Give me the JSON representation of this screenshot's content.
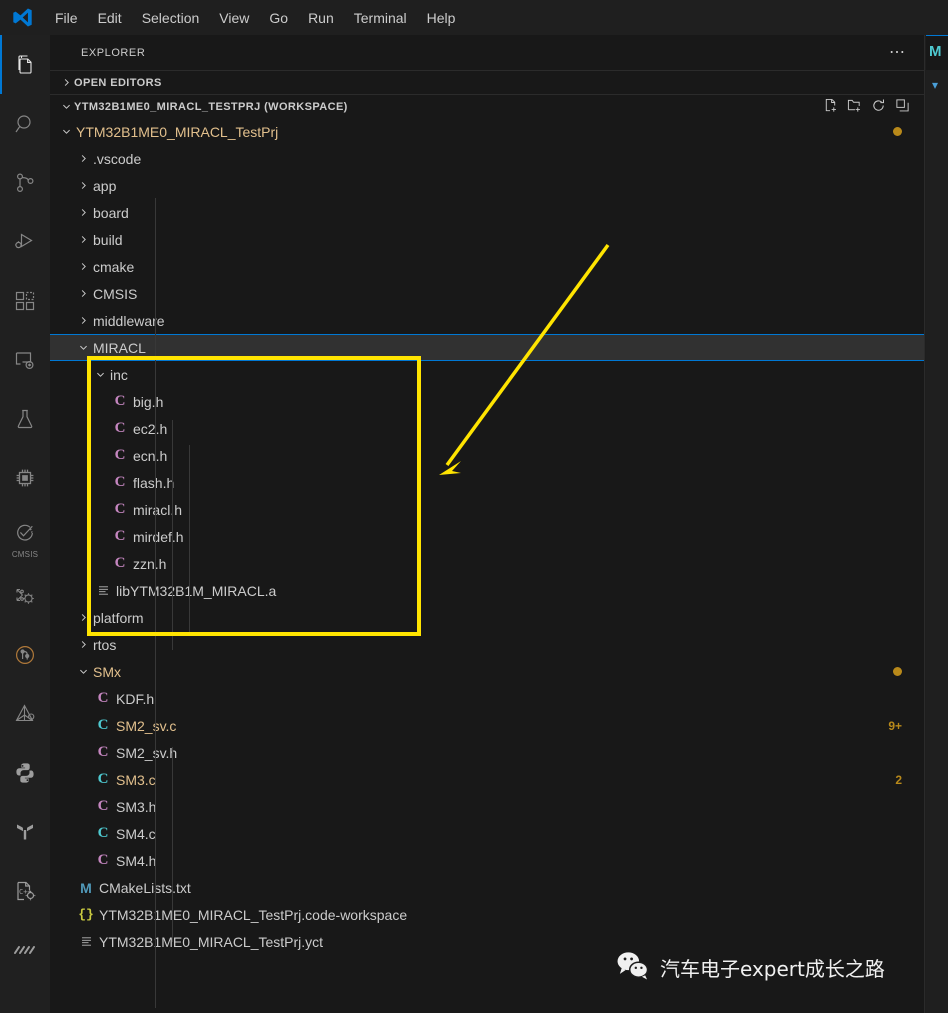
{
  "window": {
    "logo_icon": "vscode-logo-icon",
    "menu": [
      "File",
      "Edit",
      "Selection",
      "View",
      "Go",
      "Run",
      "Terminal",
      "Help"
    ]
  },
  "activity_bar": {
    "items": [
      {
        "name": "explorer",
        "icon": "files-icon",
        "active": true,
        "label": ""
      },
      {
        "name": "search",
        "icon": "search-icon",
        "active": false,
        "label": ""
      },
      {
        "name": "source-control",
        "icon": "source-control-icon",
        "active": false,
        "label": ""
      },
      {
        "name": "run-and-debug",
        "icon": "run-debug-icon",
        "active": false,
        "label": ""
      },
      {
        "name": "extensions",
        "icon": "extensions-icon",
        "active": false,
        "label": ""
      },
      {
        "name": "remote-explorer",
        "icon": "remote-explorer-icon",
        "active": false,
        "label": ""
      },
      {
        "name": "testing",
        "icon": "beaker-icon",
        "active": false,
        "label": ""
      },
      {
        "name": "embedded-tools",
        "icon": "chip-icon",
        "active": false,
        "label": ""
      },
      {
        "name": "cmsis",
        "icon": "cmsis-icon",
        "active": false,
        "label": "CMSIS"
      },
      {
        "name": "peripherals",
        "icon": "peripherals-gear-icon",
        "active": false,
        "label": ""
      },
      {
        "name": "git-graph",
        "icon": "git-graph-icon",
        "active": false,
        "label": ""
      },
      {
        "name": "embedded-debug",
        "icon": "triangle-debug-icon",
        "active": false,
        "label": ""
      },
      {
        "name": "python",
        "icon": "python-icon",
        "active": false,
        "label": ""
      },
      {
        "name": "platformio",
        "icon": "platformio-icon",
        "active": false,
        "label": ""
      },
      {
        "name": "cpp-config",
        "icon": "cpp-settings-icon",
        "active": false,
        "label": ""
      },
      {
        "name": "serial-monitor",
        "icon": "waveform-icon",
        "active": false,
        "label": ""
      }
    ]
  },
  "sidebar": {
    "title": "EXPLORER",
    "more_actions_icon": "ellipsis-icon",
    "open_editors": {
      "label": "OPEN EDITORS",
      "twisty": "chevron-right-icon",
      "expanded": false
    },
    "workspace": {
      "label": "YTM32B1ME0_MIRACL_TESTPRJ (WORKSPACE)",
      "twisty": "chevron-down-icon",
      "expanded": true,
      "actions": [
        {
          "name": "new-file-icon",
          "title": "New File"
        },
        {
          "name": "new-folder-icon",
          "title": "New Folder"
        },
        {
          "name": "refresh-icon",
          "title": "Refresh Explorer"
        },
        {
          "name": "collapse-all-icon",
          "title": "Collapse Folders in Explorer"
        }
      ]
    },
    "tree": [
      {
        "label": "YTM32B1ME0_MIRACL_TestPrj",
        "depth": 0,
        "type": "folder",
        "state": "open",
        "color": "modified",
        "badge": "dot"
      },
      {
        "label": ".vscode",
        "depth": 1,
        "type": "folder",
        "state": "closed"
      },
      {
        "label": "app",
        "depth": 1,
        "type": "folder",
        "state": "closed"
      },
      {
        "label": "board",
        "depth": 1,
        "type": "folder",
        "state": "closed"
      },
      {
        "label": "build",
        "depth": 1,
        "type": "folder",
        "state": "closed"
      },
      {
        "label": "cmake",
        "depth": 1,
        "type": "folder",
        "state": "closed"
      },
      {
        "label": "CMSIS",
        "depth": 1,
        "type": "folder",
        "state": "closed"
      },
      {
        "label": "middleware",
        "depth": 1,
        "type": "folder",
        "state": "closed"
      },
      {
        "label": "MIRACL",
        "depth": 1,
        "type": "folder",
        "state": "open",
        "focused": true
      },
      {
        "label": "inc",
        "depth": 2,
        "type": "folder",
        "state": "open"
      },
      {
        "label": "big.h",
        "depth": 3,
        "type": "file",
        "icon": "h"
      },
      {
        "label": "ec2.h",
        "depth": 3,
        "type": "file",
        "icon": "h"
      },
      {
        "label": "ecn.h",
        "depth": 3,
        "type": "file",
        "icon": "h"
      },
      {
        "label": "flash.h",
        "depth": 3,
        "type": "file",
        "icon": "h"
      },
      {
        "label": "miracl.h",
        "depth": 3,
        "type": "file",
        "icon": "h"
      },
      {
        "label": "mirdef.h",
        "depth": 3,
        "type": "file",
        "icon": "h"
      },
      {
        "label": "zzn.h",
        "depth": 3,
        "type": "file",
        "icon": "h"
      },
      {
        "label": "libYTM32B1M_MIRACL.a",
        "depth": 2,
        "type": "file",
        "icon": "plain"
      },
      {
        "label": "platform",
        "depth": 1,
        "type": "folder",
        "state": "closed"
      },
      {
        "label": "rtos",
        "depth": 1,
        "type": "folder",
        "state": "closed"
      },
      {
        "label": "SMx",
        "depth": 1,
        "type": "folder",
        "state": "open",
        "color": "modified",
        "badge": "dot"
      },
      {
        "label": "KDF.h",
        "depth": 2,
        "type": "file",
        "icon": "h"
      },
      {
        "label": "SM2_sv.c",
        "depth": 2,
        "type": "file",
        "icon": "c",
        "color": "modified",
        "badge": "9+"
      },
      {
        "label": "SM2_sv.h",
        "depth": 2,
        "type": "file",
        "icon": "h"
      },
      {
        "label": "SM3.c",
        "depth": 2,
        "type": "file",
        "icon": "c",
        "color": "modified",
        "badge": "2"
      },
      {
        "label": "SM3.h",
        "depth": 2,
        "type": "file",
        "icon": "h"
      },
      {
        "label": "SM4.c",
        "depth": 2,
        "type": "file",
        "icon": "c"
      },
      {
        "label": "SM4.h",
        "depth": 2,
        "type": "file",
        "icon": "h"
      },
      {
        "label": "CMakeLists.txt",
        "depth": 1,
        "type": "file",
        "icon": "cmake"
      },
      {
        "label": "YTM32B1ME0_MIRACL_TestPrj.code-workspace",
        "depth": 1,
        "type": "file",
        "icon": "json"
      },
      {
        "label": "YTM32B1ME0_MIRACL_TestPrj.yct",
        "depth": 1,
        "type": "file",
        "icon": "plain"
      }
    ]
  },
  "editor": {
    "tab_letter": "M",
    "breadcrumb_icon": "chevron-down-icon"
  },
  "annotations": {
    "highlight_box": {
      "name": "miracl-highlight-box",
      "color": "#ffe400"
    },
    "arrow": {
      "name": "pointer-arrow",
      "color": "#ffe400"
    }
  },
  "watermark": {
    "icon": "wechat-icon",
    "text": "汽车电子expert成长之路"
  },
  "colors": {
    "accent": "#0078d4",
    "annotation": "#ffe400",
    "modified": "#e2c08d",
    "badge": "#b8891a",
    "header_icon": "#c586c0",
    "source_icon": "#4ec9d0"
  }
}
